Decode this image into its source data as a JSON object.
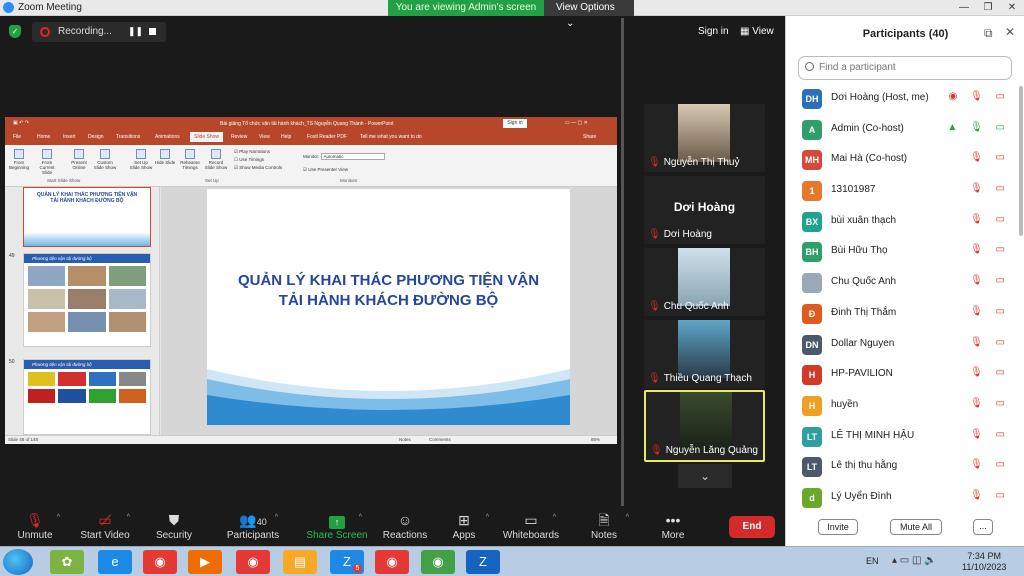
{
  "window": {
    "title": "Zoom Meeting",
    "viewing_banner": "You are viewing Admin's screen",
    "view_options": "View Options"
  },
  "meeting_bar": {
    "recording": "Recording...",
    "sign_in": "Sign in",
    "view": "View"
  },
  "shared": {
    "ppt_title": "Bài giảng Tổ chức vận tải hành khách_TS Nguyễn Quang Thành - PowerPoint",
    "sign_in": "Sign in",
    "share": "Share",
    "tabs": [
      "File",
      "Home",
      "Insert",
      "Design",
      "Transitions",
      "Animations",
      "Slide Show",
      "Review",
      "View",
      "Help",
      "Foxit Reader PDF",
      "Tell me what you want to do"
    ],
    "ribbon_buttons": [
      "From Beginning",
      "From Current Slide",
      "Present Online",
      "Custom Slide Show",
      "Set Up Slide Show",
      "Hide Slide",
      "Rehearse Timings",
      "Record Slide Show"
    ],
    "ribbon_checks": [
      "Play Narrations",
      "Use Timings",
      "Show Media Controls"
    ],
    "monitor_label": "Monitor:",
    "monitor_value": "Automatic",
    "presenter_view": "Use Presenter View",
    "groups": [
      "Start Slide Show",
      "Set Up",
      "Monitors"
    ],
    "thumb_numbers": [
      "49",
      "50"
    ],
    "thumb1_title": "QUẢN LÝ KHAI THÁC PHƯƠNG TIỆN VẬN TẢI HÀNH KHÁCH ĐƯỜNG BỘ",
    "thumb2_title": "Phương tiện vận tải đường bộ",
    "slide_title_1": "QUẢN LÝ KHAI THÁC PHƯƠNG TIỆN VẬN",
    "slide_title_2": "TẢI HÀNH KHÁCH ĐƯỜNG BỘ",
    "status_left": "Slide 48 of 148",
    "status_notes": "Notes",
    "status_comments": "Comments",
    "status_zoom": "85%"
  },
  "tiles": [
    {
      "name": "Nguyễn Thị Thuỷ"
    },
    {
      "name": "Dơi Hoàng",
      "big_name": "Dơi Hoàng"
    },
    {
      "name": "Chu Quốc Anh"
    },
    {
      "name": "Thiều Quang Thạch"
    },
    {
      "name": "Nguyễn Lăng Quảng"
    }
  ],
  "participants": {
    "title": "Participants (40)",
    "search_placeholder": "Find a participant",
    "list": [
      {
        "initials": "DH",
        "name": "Dơi Hoàng (Host, me)",
        "color": "#2d6fb8"
      },
      {
        "initials": "A",
        "name": "Admin (Co-host)",
        "color": "#2e9e6a"
      },
      {
        "initials": "MH",
        "name": "Mai Hà (Co-host)",
        "color": "#d24a3a"
      },
      {
        "initials": "1",
        "name": "13101987",
        "color": "#e8772e"
      },
      {
        "initials": "BX",
        "name": "bùi  xuân thạch",
        "color": "#1fa38f"
      },
      {
        "initials": "BH",
        "name": "Bùi Hữu Thọ",
        "color": "#2e9e6a"
      },
      {
        "initials": "",
        "name": "Chu Quốc Anh",
        "color": "#9aa8b8"
      },
      {
        "initials": "Đ",
        "name": "Đinh Thị Thắm",
        "color": "#e05a1e"
      },
      {
        "initials": "DN",
        "name": "Dollar Nguyen",
        "color": "#4a5a6a"
      },
      {
        "initials": "H",
        "name": "HP-PAVILION",
        "color": "#d23a2a"
      },
      {
        "initials": "H",
        "name": "huyền",
        "color": "#f0a020"
      },
      {
        "initials": "LT",
        "name": "LÊ THỊ MINH HẬU",
        "color": "#2ea0a0"
      },
      {
        "initials": "LT",
        "name": "Lê thị thu hằng",
        "color": "#4a5a6a"
      },
      {
        "initials": "d",
        "name": "Lý Uyển Đình",
        "color": "#6aa82a"
      }
    ],
    "invite": "Invite",
    "mute_all": "Mute All",
    "more": "..."
  },
  "toolbar": {
    "unmute": "Unmute",
    "start_video": "Start Video",
    "security": "Security",
    "participants": "Participants",
    "participants_count": "40",
    "share_screen": "Share Screen",
    "reactions": "Reactions",
    "apps": "Apps",
    "whiteboards": "Whiteboards",
    "notes": "Notes",
    "more": "More",
    "end": "End"
  },
  "taskbar": {
    "lang": "EN",
    "time": "7:34 PM",
    "date": "11/10/2023",
    "zalo_badge": "5"
  }
}
